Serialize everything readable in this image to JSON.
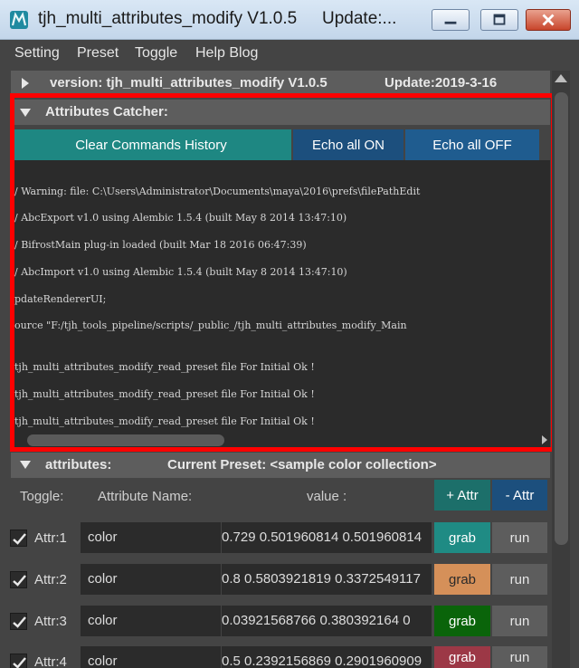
{
  "window": {
    "title": "tjh_multi_attributes_modify V1.0.5",
    "update_short": "Update:..."
  },
  "menu": [
    "Setting",
    "Preset",
    "Toggle",
    "Help Blog"
  ],
  "version_frame": {
    "version_text": "version:   tjh_multi_attributes_modify V1.0.5",
    "update_text": "Update:2019-3-16"
  },
  "catcher_frame": {
    "title": "Attributes Catcher:",
    "clear_label": "Clear Commands History",
    "echo_on_label": "Echo all ON",
    "echo_off_label": "Echo all OFF",
    "log_lines": [
      "/ Warning: file: C:\\Users\\Administrator\\Documents\\maya\\2016\\prefs\\filePathEdit",
      "/ AbcExport v1.0 using Alembic 1.5.4 (built May  8 2014 13:47:10)",
      "/ BifrostMain plug-in loaded (built Mar 18 2016 06:47:39)",
      "/ AbcImport v1.0 using Alembic 1.5.4 (built May  8 2014 13:47:10)",
      "pdateRendererUI;",
      "ource \"F:/tjh_tools_pipeline/scripts/_public_/tjh_multi_attributes_modify_Main",
      "tjh_multi_attributes_modify_read_preset file For Initial Ok  !",
      " tjh_multi_attributes_modify_read_preset file For Initial Ok  !",
      " tjh_multi_attributes_modify_read_preset file For Initial Ok  !"
    ]
  },
  "attributes_frame": {
    "title": "attributes:",
    "preset_text": "Current Preset: <sample color collection>",
    "col_toggle": "Toggle:",
    "col_name": "Attribute Name:",
    "col_value": "value :",
    "add_label": "+ Attr",
    "remove_label": "- Attr",
    "rows": [
      {
        "label": "Attr:1",
        "name": "color",
        "value": "0.729  0.501960814  0.501960814",
        "grab": "grab",
        "run": "run",
        "grab_color": "#1f8b84",
        "grab_text_color": "#ffffff"
      },
      {
        "label": "Attr:2",
        "name": "color",
        "value": "0.8  0.5803921819  0.3372549117",
        "grab": "grab",
        "run": "run",
        "grab_color": "#d59059",
        "grab_text_color": "#2a2a2a"
      },
      {
        "label": "Attr:3",
        "name": "color",
        "value": "0.03921568766  0.380392164  0",
        "grab": "grab",
        "run": "run",
        "grab_color": "#0a640a",
        "grab_text_color": "#ffffff"
      },
      {
        "label": "Attr:4",
        "name": "color",
        "value": "0.5  0.2392156869  0.2901960909",
        "grab": "grab",
        "run": "run",
        "grab_color": "#9c3846",
        "grab_text_color": "#ffffff"
      }
    ]
  },
  "colors": {
    "teal": "#1e8782",
    "blue_dark": "#1c4f7d",
    "blue_mid": "#1f5c8f",
    "highlight": "#ff0000"
  }
}
